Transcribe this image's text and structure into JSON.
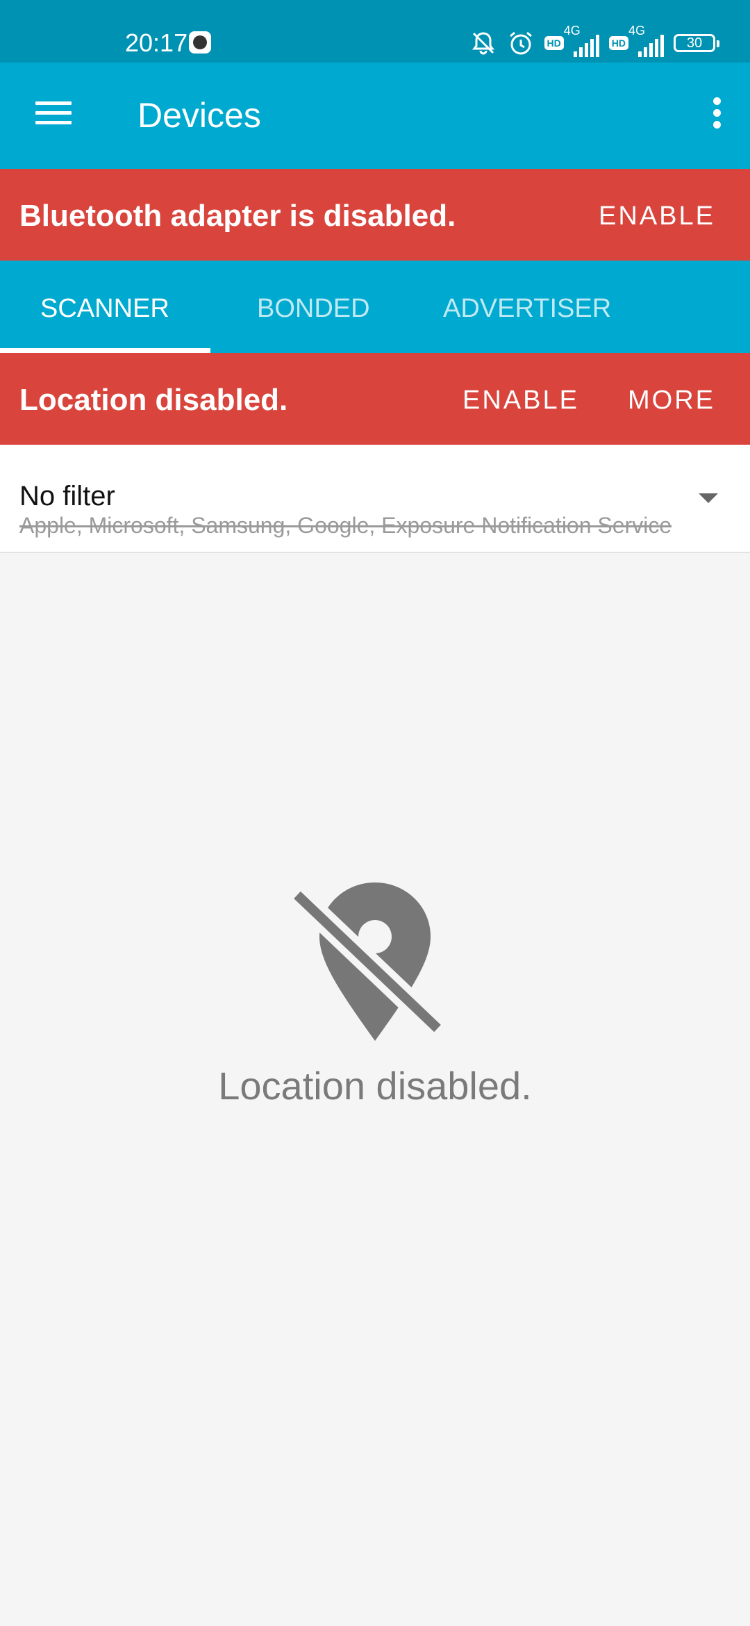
{
  "status_bar": {
    "time": "20:17",
    "sim1": {
      "hd": "HD",
      "network": "4G"
    },
    "sim2": {
      "hd": "HD",
      "network": "4G"
    },
    "battery": "30"
  },
  "app_bar": {
    "title": "Devices"
  },
  "bluetooth_banner": {
    "message": "Bluetooth adapter is disabled.",
    "enable_label": "ENABLE"
  },
  "tabs": [
    {
      "label": "SCANNER",
      "active": true
    },
    {
      "label": "BONDED",
      "active": false
    },
    {
      "label": "ADVERTISER",
      "active": false
    }
  ],
  "location_banner": {
    "message": "Location disabled.",
    "enable_label": "ENABLE",
    "more_label": "MORE"
  },
  "filter": {
    "title": "No filter",
    "excluded": "Apple, Microsoft, Samsung, Google, Exposure Notification Service"
  },
  "empty_state": {
    "message": "Location disabled.",
    "icon": "location-off-icon"
  },
  "colors": {
    "status_bar": "#0092b2",
    "primary": "#00a9cf",
    "warning_banner": "#d9453d",
    "background": "#f5f5f5",
    "empty_icon": "#777777"
  }
}
